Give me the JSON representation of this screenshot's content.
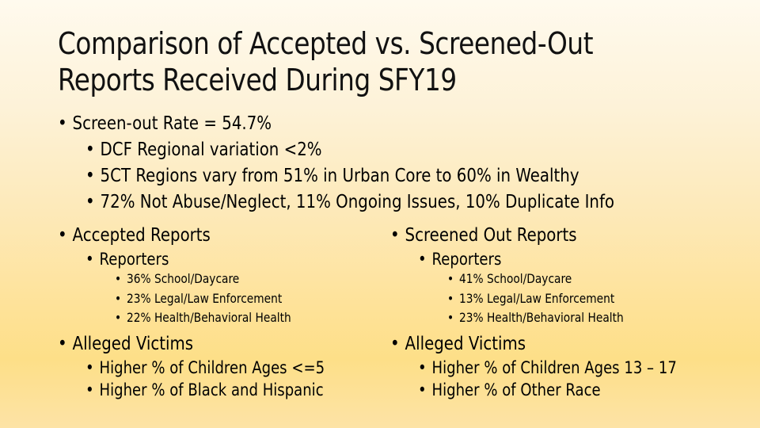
{
  "slide": {
    "title_line1": "Comparison of Accepted vs. Screened-Out",
    "title_line2": "Reports Received During SFY19",
    "background": {
      "top": "#fffaee",
      "bottom": "#fddf88"
    },
    "summary": {
      "heading": "Screen-out Rate = 54.7%",
      "items": [
        "DCF Regional variation <2%",
        "5CT Regions vary from 51% in Urban Core to 60% in Wealthy",
        "72% Not Abuse/Neglect, 11% Ongoing Issues, 10% Duplicate Info"
      ]
    },
    "columns": [
      {
        "heading": "Accepted Reports",
        "reporters_label": "Reporters",
        "reporters": [
          "36% School/Daycare",
          "23% Legal/Law Enforcement",
          "22% Health/Behavioral Health"
        ],
        "victims_label": "Alleged Victims",
        "victims": [
          "Higher % of Children Ages <=5",
          "Higher % of Black and Hispanic"
        ]
      },
      {
        "heading": "Screened Out Reports",
        "reporters_label": "Reporters",
        "reporters": [
          "41% School/Daycare",
          "13% Legal/Law Enforcement",
          "23% Health/Behavioral Health"
        ],
        "victims_label": "Alleged Victims",
        "victims": [
          "Higher % of Children Ages 13 – 17",
          "Higher % of Other Race"
        ]
      }
    ]
  }
}
